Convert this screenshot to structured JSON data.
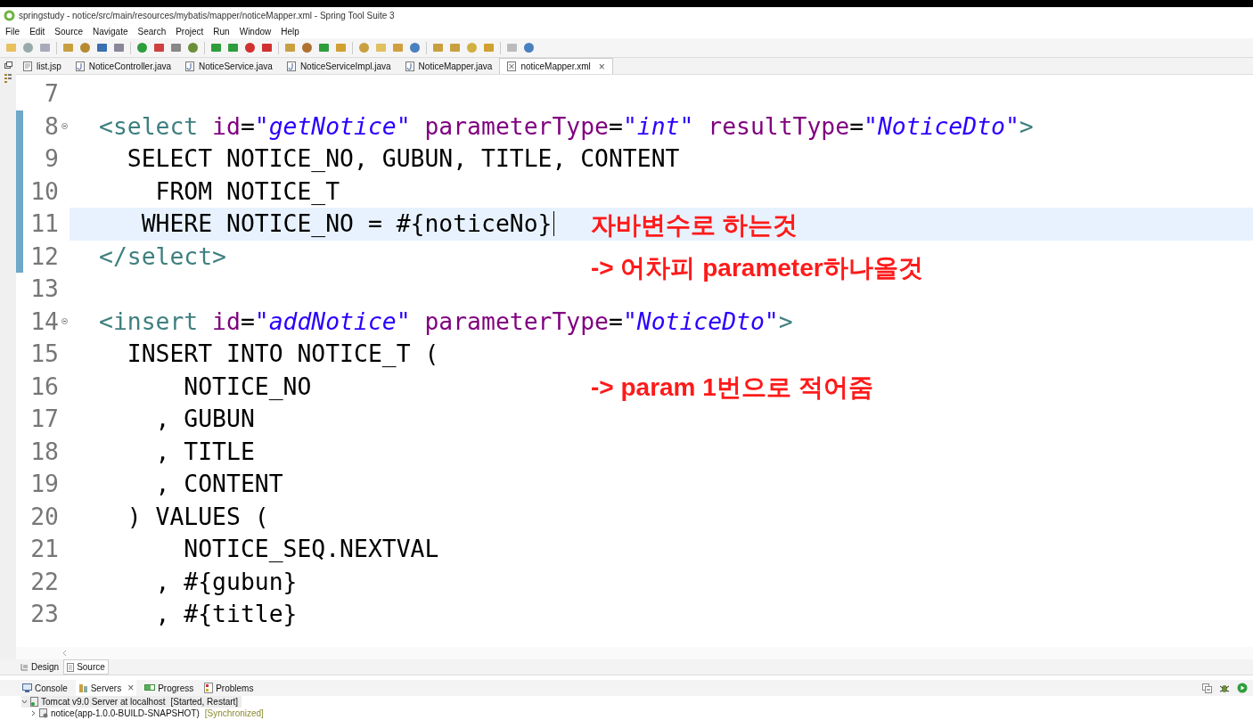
{
  "window": {
    "title": "springstudy - notice/src/main/resources/mybatis/mapper/noticeMapper.xml - Spring Tool Suite 3"
  },
  "menu": [
    "File",
    "Edit",
    "Source",
    "Navigate",
    "Search",
    "Project",
    "Run",
    "Window",
    "Help"
  ],
  "editor_tabs": [
    {
      "label": "list.jsp",
      "kind": "jsp",
      "selected": false
    },
    {
      "label": "NoticeController.java",
      "kind": "java",
      "selected": false
    },
    {
      "label": "NoticeService.java",
      "kind": "java",
      "selected": false
    },
    {
      "label": "NoticeServiceImpl.java",
      "kind": "java",
      "selected": false
    },
    {
      "label": "NoticeMapper.java",
      "kind": "java",
      "selected": false
    },
    {
      "label": "noticeMapper.xml",
      "kind": "xml",
      "selected": true,
      "close": "×"
    }
  ],
  "code_lines": [
    {
      "number": "7",
      "changed": false,
      "current": false,
      "fold": false
    },
    {
      "number": "8",
      "changed": true,
      "current": false,
      "fold": true,
      "tokens": [
        {
          "kind": "tag",
          "text": "<select "
        },
        {
          "kind": "attr",
          "text": "id"
        },
        {
          "kind": "plain",
          "text": "="
        },
        {
          "kind": "value",
          "text": "\"getNotice\" "
        },
        {
          "kind": "attr",
          "text": "parameterType"
        },
        {
          "kind": "plain",
          "text": "="
        },
        {
          "kind": "value",
          "text": "\"int\" "
        },
        {
          "kind": "attr",
          "text": "resultType"
        },
        {
          "kind": "plain",
          "text": "="
        },
        {
          "kind": "value",
          "text": "\"NoticeDto\""
        },
        {
          "kind": "tag",
          "text": ">"
        }
      ]
    },
    {
      "number": "9",
      "changed": true,
      "current": false,
      "fold": false,
      "tokens": [
        {
          "kind": "plain",
          "text": "  SELECT NOTICE_NO, GUBUN, TITLE, CONTENT"
        }
      ]
    },
    {
      "number": "10",
      "changed": true,
      "current": false,
      "fold": false,
      "tokens": [
        {
          "kind": "plain",
          "text": "    FROM NOTICE_T"
        }
      ]
    },
    {
      "number": "11",
      "changed": true,
      "current": true,
      "fold": false,
      "tokens": [
        {
          "kind": "plain",
          "text": "   WHERE NOTICE_NO = #{noticeNo}"
        }
      ]
    },
    {
      "number": "12",
      "changed": true,
      "current": false,
      "fold": false,
      "tokens": [
        {
          "kind": "tag",
          "text": "</select>"
        }
      ]
    },
    {
      "number": "13",
      "changed": false,
      "current": false,
      "fold": false
    },
    {
      "number": "14",
      "changed": false,
      "current": false,
      "fold": true,
      "tokens": [
        {
          "kind": "tag",
          "text": "<insert "
        },
        {
          "kind": "attr",
          "text": "id"
        },
        {
          "kind": "plain",
          "text": "="
        },
        {
          "kind": "value",
          "text": "\"addNotice\" "
        },
        {
          "kind": "attr",
          "text": "parameterType"
        },
        {
          "kind": "plain",
          "text": "="
        },
        {
          "kind": "value",
          "text": "\"NoticeDto\""
        },
        {
          "kind": "tag",
          "text": ">"
        }
      ]
    },
    {
      "number": "15",
      "changed": false,
      "current": false,
      "fold": false,
      "tokens": [
        {
          "kind": "plain",
          "text": "  INSERT INTO NOTICE_T ("
        }
      ]
    },
    {
      "number": "16",
      "changed": false,
      "current": false,
      "fold": false,
      "tokens": [
        {
          "kind": "plain",
          "text": "      NOTICE_NO"
        }
      ]
    },
    {
      "number": "17",
      "changed": false,
      "current": false,
      "fold": false,
      "tokens": [
        {
          "kind": "plain",
          "text": "    , GUBUN"
        }
      ]
    },
    {
      "number": "18",
      "changed": false,
      "current": false,
      "fold": false,
      "tokens": [
        {
          "kind": "plain",
          "text": "    , TITLE"
        }
      ]
    },
    {
      "number": "19",
      "changed": false,
      "current": false,
      "fold": false,
      "tokens": [
        {
          "kind": "plain",
          "text": "    , CONTENT"
        }
      ]
    },
    {
      "number": "20",
      "changed": false,
      "current": false,
      "fold": false,
      "tokens": [
        {
          "kind": "plain",
          "text": "  ) VALUES ("
        }
      ]
    },
    {
      "number": "21",
      "changed": false,
      "current": false,
      "fold": false,
      "tokens": [
        {
          "kind": "plain",
          "text": "      NOTICE_SEQ.NEXTVAL"
        }
      ]
    },
    {
      "number": "22",
      "changed": false,
      "current": false,
      "fold": false,
      "tokens": [
        {
          "kind": "plain",
          "text": "    , #{gubun}"
        }
      ]
    },
    {
      "number": "23",
      "changed": false,
      "current": false,
      "fold": false,
      "tokens": [
        {
          "kind": "plain",
          "text": "    , #{title}"
        }
      ]
    }
  ],
  "annotations": [
    "자바변수로 하는것",
    "-> 어차피 parameter하나올것",
    "-> param 1번으로 적어줌"
  ],
  "editor_mode_tabs": [
    {
      "label": "Design",
      "selected": false
    },
    {
      "label": "Source",
      "selected": true
    }
  ],
  "panel_tabs": [
    {
      "label": "Console",
      "kind": "console",
      "selected": false
    },
    {
      "label": "Servers",
      "kind": "servers",
      "selected": true,
      "close": "×"
    },
    {
      "label": "Progress",
      "kind": "progress",
      "selected": false
    },
    {
      "label": "Problems",
      "kind": "problems",
      "selected": false
    }
  ],
  "servers": [
    {
      "name": "Tomcat v9.0 Server at localhost",
      "state": "[Started, Restart]",
      "expanded": true,
      "children": [
        {
          "name": "notice(app-1.0.0-BUILD-SNAPSHOT)",
          "state": "[Synchronized]",
          "expanded": false
        }
      ]
    }
  ]
}
